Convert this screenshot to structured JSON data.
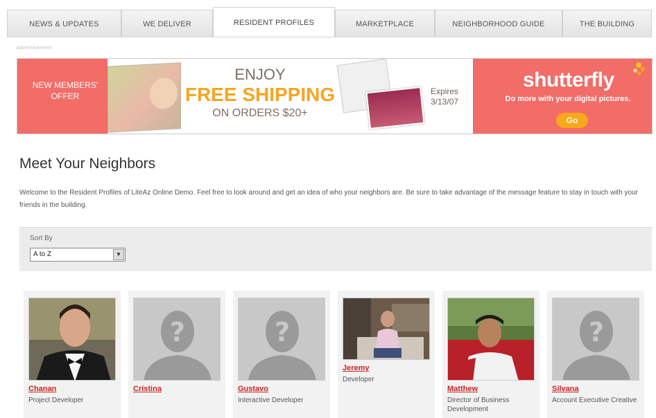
{
  "nav": {
    "tabs": [
      {
        "label": "NEWS & UPDATES",
        "active": false
      },
      {
        "label": "WE DELIVER",
        "active": false
      },
      {
        "label": "RESIDENT PROFILES",
        "active": true
      },
      {
        "label": "MARKETPLACE",
        "active": false
      },
      {
        "label": "NEIGHBORHOOD GUIDE",
        "active": false
      },
      {
        "label": "THE BUILDING",
        "active": false
      }
    ]
  },
  "ad": {
    "label": "advertisement",
    "offer": "NEW MEMBERS' OFFER",
    "enjoy": "ENJOY",
    "free_shipping": "FREE SHIPPING",
    "orders": "ON ORDERS $20+",
    "expires_label": "Expires",
    "expires_date": "3/13/07",
    "brand": "shutterfly",
    "tagline": "Do more with your digital pictures.",
    "cta": "Go",
    "colors": {
      "banner_red": "#f26c68",
      "accent_orange": "#f7a81b"
    }
  },
  "main": {
    "title": "Meet Your Neighbors",
    "intro": "Welcome to the Resident Profiles of LiteAz Online Demo. Feel free to look around and get an idea of who your neighbors are. Be sure to take advantage of the message feature to stay in touch with your friends in the building."
  },
  "sort": {
    "label": "Sort By",
    "selected": "A to Z",
    "arrow_icon": "chevron-down-icon"
  },
  "profiles": [
    {
      "name": "Chanan",
      "role": "Project Developer",
      "photo": "man-in-tuxedo-photo"
    },
    {
      "name": "Cristina",
      "role": "",
      "photo": "silhouette-placeholder"
    },
    {
      "name": "Gustavo",
      "role": "Interactive Developer",
      "photo": "silhouette-placeholder"
    },
    {
      "name": "Jeremy",
      "role": "Developer",
      "photo": "man-on-sofa-photo"
    },
    {
      "name": "Matthew",
      "role": "Director of Business Development",
      "photo": "man-by-truck-photo"
    },
    {
      "name": "Silvana",
      "role": "Account Executive Creative",
      "photo": "silhouette-placeholder"
    }
  ]
}
